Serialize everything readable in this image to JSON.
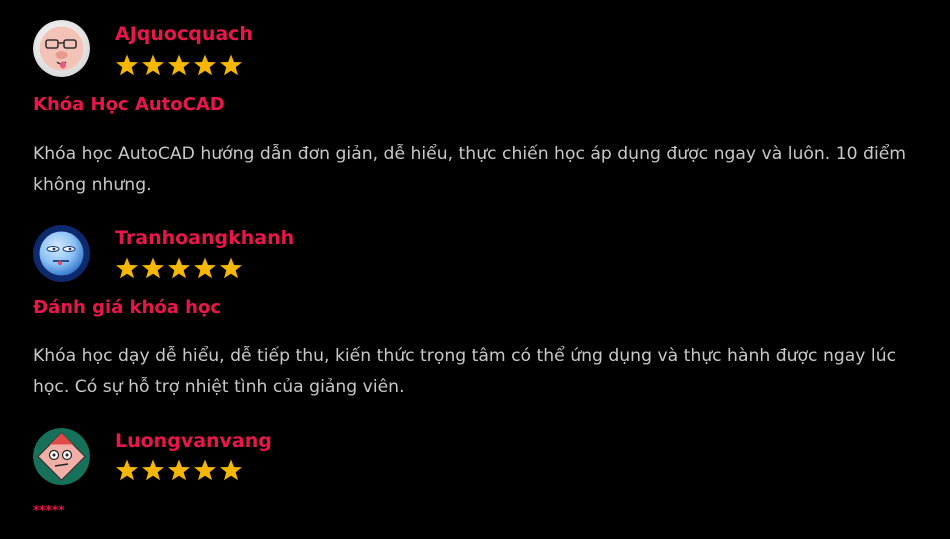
{
  "reviews": [
    {
      "author": "AJquocquach",
      "rating": 5,
      "title": "Khóa Học AutoCAD",
      "body": "Khóa học AutoCAD hướng dẫn đơn giản, dễ hiểu, thực chiến học áp dụng được ngay và luôn. 10 điểm không nhưng."
    },
    {
      "author": "Tranhoangkhanh",
      "rating": 5,
      "title": "Đánh giá khóa học",
      "body": "Khóa học dạy dễ hiểu, dễ tiếp thu, kiến thức trọng tâm có thể ứng dụng và thực hành được ngay lúc học. Có sự hỗ trợ nhiệt tình của giảng viên."
    },
    {
      "author": "Luongvanvang",
      "rating": 5,
      "title": "*****"
    }
  ],
  "colors": {
    "accent": "#e8174a",
    "star": "#f5b700",
    "background": "#000000",
    "text": "#c8c8c8"
  },
  "icons": [
    "star-icon"
  ]
}
